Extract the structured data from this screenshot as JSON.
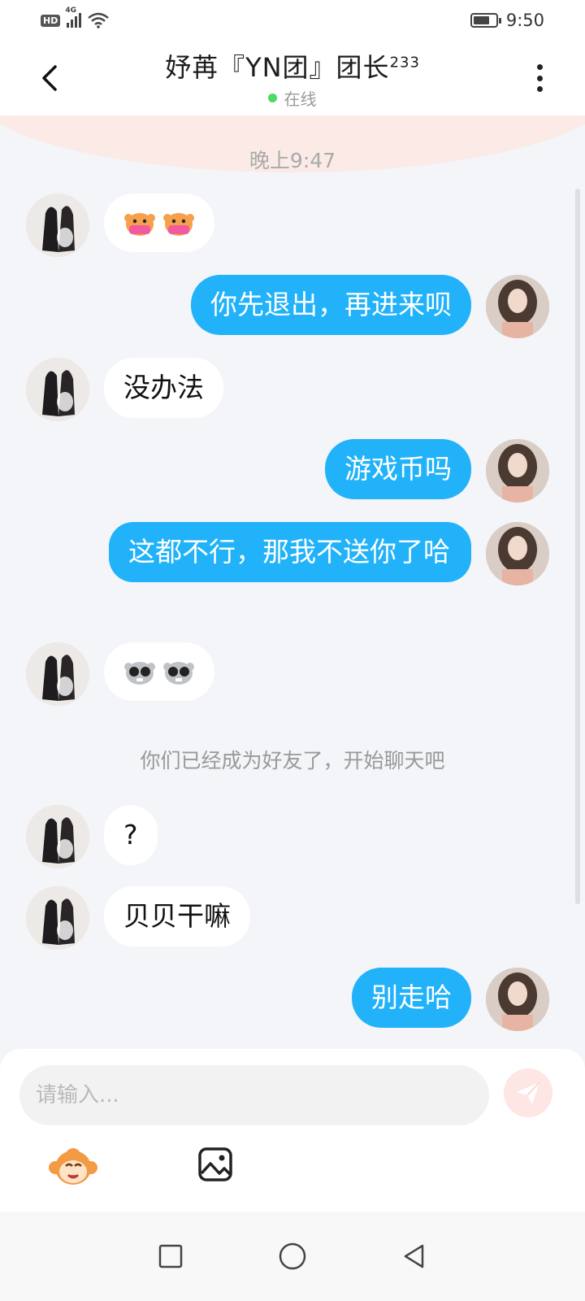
{
  "status_bar": {
    "hd": "HD",
    "network": "4G",
    "time": "9:50",
    "icons": [
      "signal-icon",
      "wifi-icon",
      "battery-icon"
    ]
  },
  "header": {
    "title": "妤苒『YN团』团长",
    "title_suffix": "233",
    "status": "在线",
    "status_color": "#4cd964"
  },
  "chat": {
    "time_label": "晚上9:47",
    "system_notice": "你们已经成为好友了，开始聊天吧",
    "messages": [
      {
        "side": "left",
        "type": "emoji",
        "content": "monkey-masked-emoji x2"
      },
      {
        "side": "right",
        "type": "text",
        "text": "你先退出，再进来呗"
      },
      {
        "side": "left",
        "type": "text",
        "text": "没办法"
      },
      {
        "side": "right",
        "type": "text",
        "text": "游戏币吗"
      },
      {
        "side": "right",
        "type": "text",
        "text": "这都不行，那我不送你了哈"
      },
      {
        "side": "left",
        "type": "emoji",
        "content": "monkey-sunglasses-emoji x2"
      },
      {
        "side": "left",
        "type": "text",
        "text": "?"
      },
      {
        "side": "left",
        "type": "text",
        "text": "贝贝干嘛"
      },
      {
        "side": "right",
        "type": "text",
        "text": "别走哈"
      }
    ],
    "bubble_color_self": "#21b2f9",
    "bubble_color_other": "#ffffff"
  },
  "input": {
    "placeholder": "请输入...",
    "send_icon": "send-icon",
    "tools": [
      "monkey-emoji-icon",
      "image-icon"
    ]
  },
  "nav": {
    "buttons": [
      "recent-apps-icon",
      "home-icon",
      "back-icon"
    ]
  }
}
